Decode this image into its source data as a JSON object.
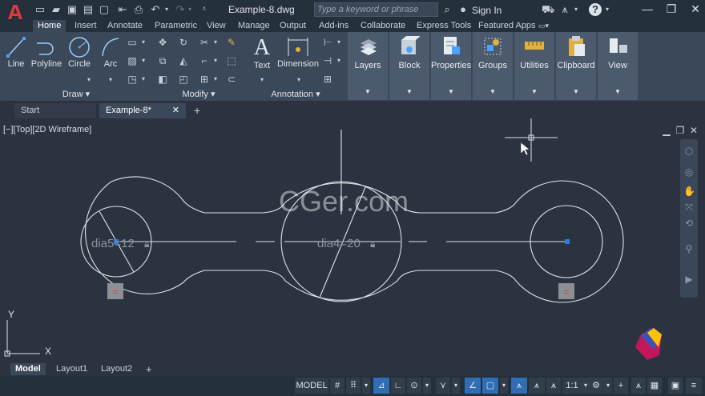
{
  "title": {
    "doc": "Example-8.dwg",
    "search_placeholder": "Type a keyword or phrase",
    "signin": "Sign In"
  },
  "ribbon_tabs": [
    "Home",
    "Insert",
    "Annotate",
    "Parametric",
    "View",
    "Manage",
    "Output",
    "Add-ins",
    "Collaborate",
    "Express Tools",
    "Featured Apps"
  ],
  "draw": {
    "line": "Line",
    "polyline": "Polyline",
    "circle": "Circle",
    "arc": "Arc",
    "title": "Draw"
  },
  "modify": {
    "title": "Modify"
  },
  "annotation": {
    "text": "Text",
    "dimension": "Dimension",
    "title": "Annotation"
  },
  "panels": {
    "layers": "Layers",
    "block": "Block",
    "properties": "Properties",
    "groups": "Groups",
    "utilities": "Utilities",
    "clipboard": "Clipboard",
    "view": "View"
  },
  "file_tabs": {
    "start": "Start",
    "current": "Example-8*"
  },
  "viewport": {
    "label": "[−][Top][2D Wireframe]",
    "dim_left": "dia5=12",
    "dim_center": "dia4=20",
    "watermark": "CGer.com"
  },
  "ucs": {
    "x": "X",
    "y": "Y"
  },
  "layout_tabs": [
    "Model",
    "Layout1",
    "Layout2"
  ],
  "status": {
    "model": "MODEL",
    "scale": "1:1"
  },
  "colors": {
    "accent": "#2f6db5",
    "geometry": "#dfe3ea",
    "background": "#2b3340"
  }
}
